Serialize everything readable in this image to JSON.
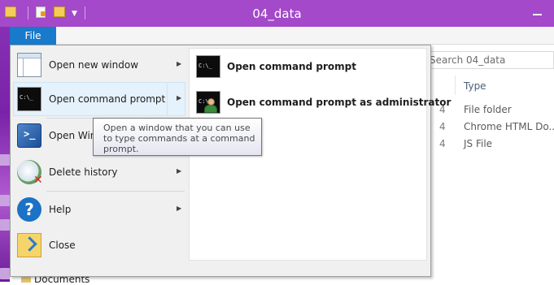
{
  "window": {
    "title": "04_data"
  },
  "tabs": {
    "file": "File"
  },
  "explorer": {
    "search_placeholder": "Search 04_data",
    "column_type": "Type",
    "rows": [
      {
        "date_fragment": "4",
        "type": "File folder"
      },
      {
        "date_fragment": "4",
        "type": "Chrome HTML Do..."
      },
      {
        "date_fragment": "4",
        "type": "JS File"
      }
    ],
    "nav_documents": "Documents"
  },
  "file_menu": {
    "items": [
      {
        "label": "Open new window",
        "icon": "window-icon",
        "has_submenu": true
      },
      {
        "label": "Open command prompt",
        "icon": "command-prompt-icon",
        "has_submenu": true,
        "active": true
      },
      {
        "label": "Open Windows PowerShell",
        "icon": "powershell-icon",
        "has_submenu": true
      },
      {
        "label": "Delete history",
        "icon": "delete-history-icon",
        "has_submenu": true
      },
      {
        "label": "Help",
        "icon": "help-icon",
        "has_submenu": true
      },
      {
        "label": "Close",
        "icon": "close-folder-icon",
        "has_submenu": false
      }
    ],
    "submenu": [
      {
        "label": "Open command prompt",
        "icon": "command-prompt-icon"
      },
      {
        "label": "Open command prompt as administrator",
        "icon": "admin-command-prompt-icon"
      }
    ],
    "tooltip": {
      "line1": "Open a window that you can use",
      "line2": "to type commands at a command",
      "line3": "prompt."
    }
  },
  "icons": {
    "cmd_text": "C:\\_"
  },
  "colors": {
    "titlebar": "#a349c9",
    "file_tab": "#1979ca",
    "menu_bg": "#f0f0f0",
    "active_item": "#e5f1fb"
  }
}
